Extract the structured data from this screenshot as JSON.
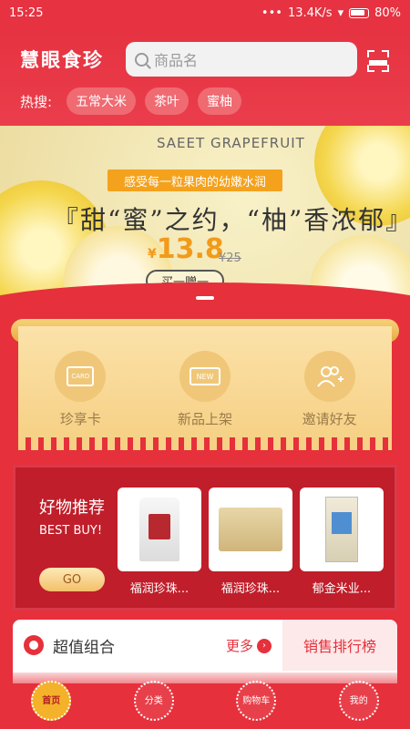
{
  "status_bar": {
    "time": "15:25",
    "dots": "•••",
    "speed": "13.4K/s",
    "battery": "80%"
  },
  "header": {
    "brand": "慧眼食珍",
    "search_placeholder": "商品名",
    "hot_label": "热搜:",
    "hot_tags": [
      "五常大米",
      "茶叶",
      "蜜柚"
    ]
  },
  "banner": {
    "title": "SAEET GRAPEFRUIT",
    "ribbon": "感受每一粒果肉的幼嫩水润",
    "headline": "『甜“蜜”之约，“柚”香浓郁』",
    "currency": "¥",
    "price": "13.8",
    "old_price": "¥25",
    "button": "买一赠一"
  },
  "features": [
    {
      "icon": "card-icon",
      "icon_text": "CARD",
      "label": "珍享卡"
    },
    {
      "icon": "new-icon",
      "icon_text": "NEW",
      "label": "新品上架"
    },
    {
      "icon": "invite-friends-icon",
      "icon_text": "",
      "label": "邀请好友"
    }
  ],
  "recommend": {
    "title": "好物推荐",
    "subtitle": "BEST BUY!",
    "go": "GO",
    "products": [
      {
        "name": "福润珍珠..."
      },
      {
        "name": "福润珍珠..."
      },
      {
        "name": "郁金米业..."
      }
    ]
  },
  "combo": {
    "title": "超值组合",
    "more": "更多",
    "rank": "销售排行榜"
  },
  "nav": [
    {
      "label": "首页",
      "active": true
    },
    {
      "label": "分类",
      "active": false
    },
    {
      "label": "购物车",
      "active": false
    },
    {
      "label": "我的",
      "active": false
    }
  ]
}
